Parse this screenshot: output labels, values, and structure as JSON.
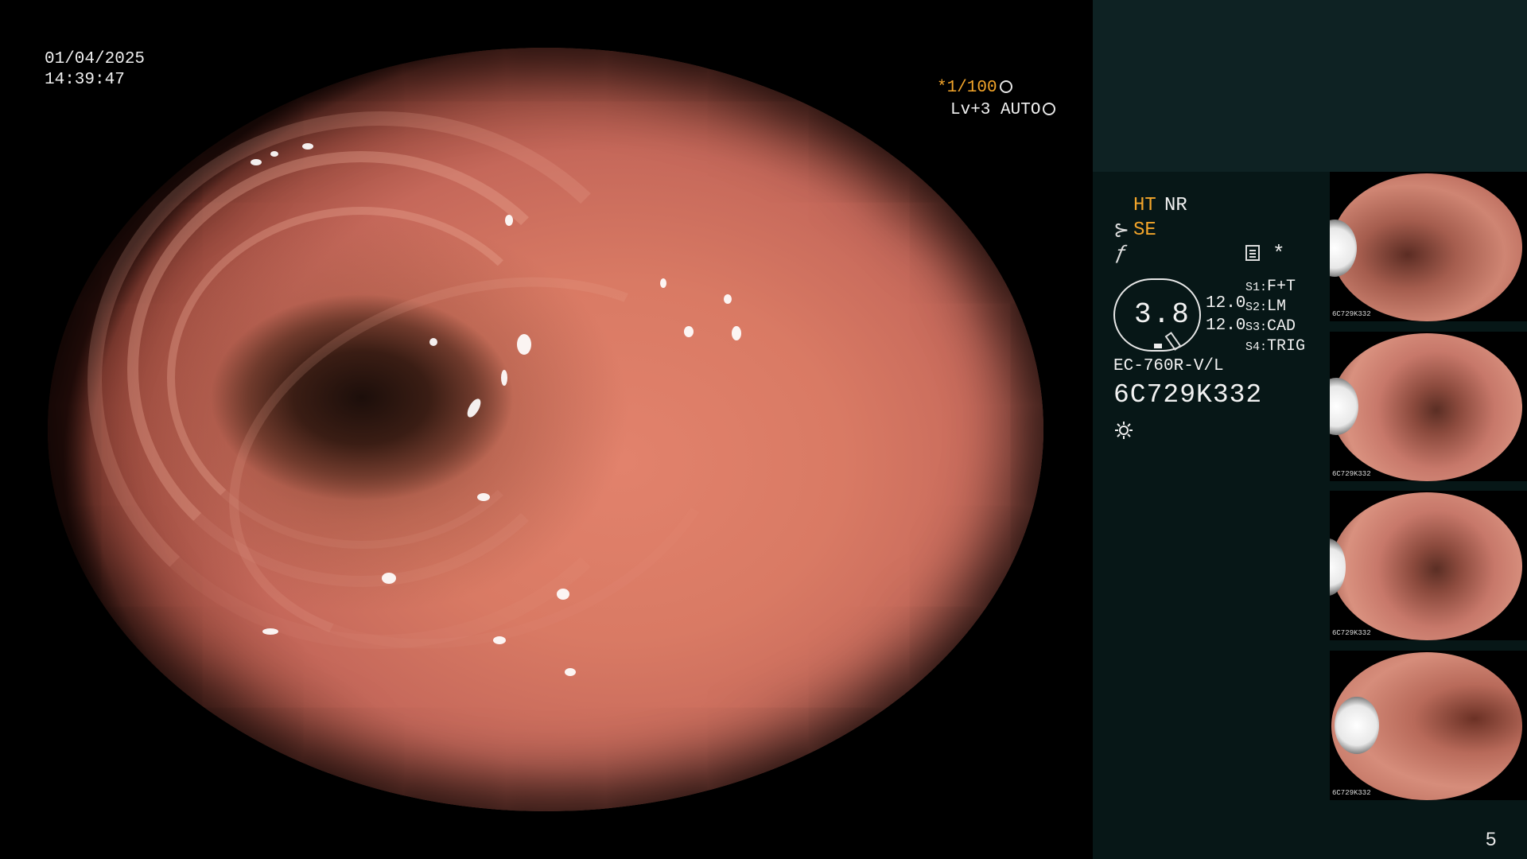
{
  "main_view": {
    "date": "01/04/2025",
    "time": "14:39:47",
    "shutter": "*1/100",
    "level": "Lv+3 AUTO"
  },
  "info": {
    "ht": "HT",
    "nr": "NR",
    "se": "SE",
    "star": "*",
    "ratio": "3.8",
    "value1": "12.0",
    "value2": "12.0",
    "switches": [
      {
        "key": "S1:",
        "value": "F+T"
      },
      {
        "key": "S2:",
        "value": "LM"
      },
      {
        "key": "S3:",
        "value": "CAD"
      },
      {
        "key": "S4:",
        "value": "TRIG"
      }
    ],
    "scope_model": "EC-760R-V/L",
    "scope_serial": "6C729K332"
  },
  "thumbnails": [
    {
      "serial": "6C729K332"
    },
    {
      "serial": "6C729K332"
    },
    {
      "serial": "6C729K332"
    },
    {
      "serial": "6C729K332"
    }
  ],
  "page_number": "5",
  "icons": {
    "se_icon": "scope-tip-icon",
    "f_icon": "freeze-icon",
    "memo_icon": "memo-icon",
    "light_icon": "light-sun-icon"
  },
  "colors": {
    "accent": "#f3a52a",
    "panel_top": "#0e2223",
    "panel": "#071717"
  }
}
